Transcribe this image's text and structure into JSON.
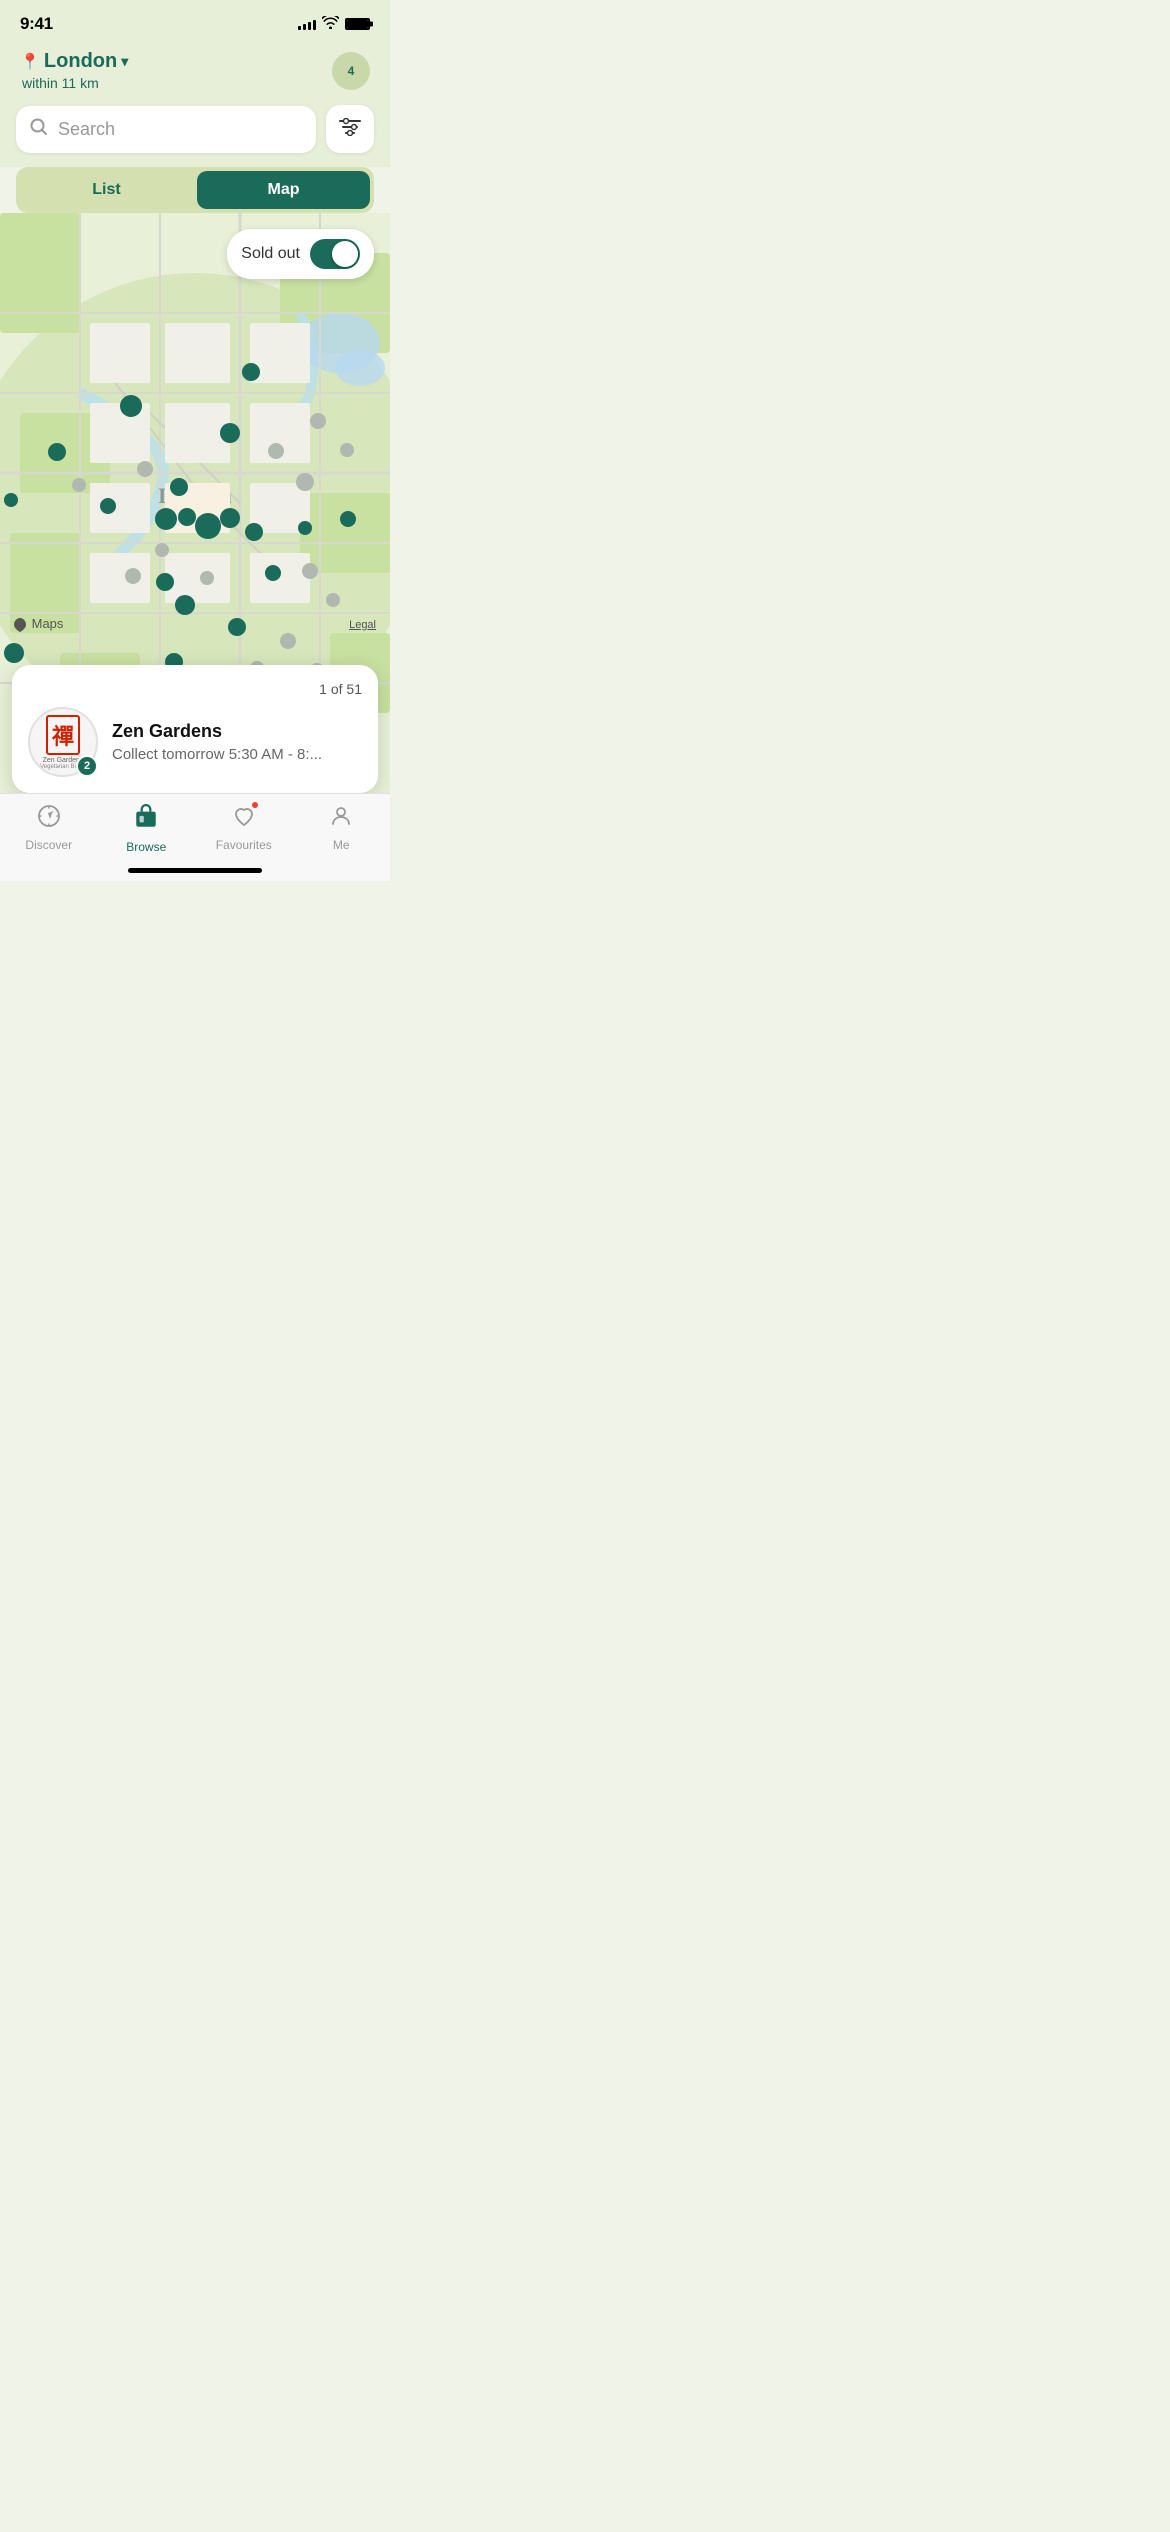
{
  "statusBar": {
    "time": "9:41",
    "signalBars": [
      4,
      6,
      8,
      10,
      12
    ],
    "batteryFull": true
  },
  "header": {
    "locationPin": "📍",
    "city": "London",
    "chevron": "▾",
    "radius": "within 11 km",
    "avatarLabel": "4"
  },
  "search": {
    "placeholder": "Search",
    "filterIcon": "⊞"
  },
  "tabs": [
    {
      "id": "list",
      "label": "List",
      "active": false
    },
    {
      "id": "map",
      "label": "Map",
      "active": true
    }
  ],
  "map": {
    "soldOutLabel": "Sold out",
    "soldOutEnabled": true
  },
  "storeCard": {
    "countLabel": "1 of 51",
    "name": "Zen Gardens",
    "collectInfo": "Collect tomorrow 5:30 AM - 8:...",
    "badge": "2"
  },
  "bottomNav": [
    {
      "id": "discover",
      "label": "Discover",
      "icon": "compass",
      "active": false
    },
    {
      "id": "browse",
      "label": "Browse",
      "icon": "bag",
      "active": true
    },
    {
      "id": "favourites",
      "label": "Favourites",
      "icon": "heart",
      "active": false,
      "hasBadge": true
    },
    {
      "id": "me",
      "label": "Me",
      "icon": "person",
      "active": false
    }
  ]
}
